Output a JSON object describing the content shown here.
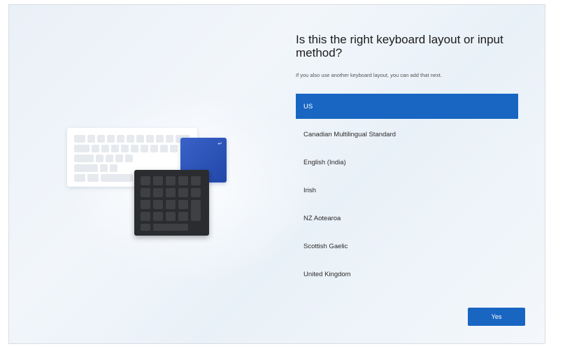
{
  "window": {
    "title": "Is this the right keyboard layout or input method?",
    "subtitle": "If you also use another keyboard layout, you can add that next."
  },
  "layouts": {
    "selected": "US",
    "items": [
      {
        "label": "US"
      },
      {
        "label": "Canadian Multilingual Standard"
      },
      {
        "label": "English (India)"
      },
      {
        "label": "Irish"
      },
      {
        "label": "NZ Aotearoa"
      },
      {
        "label": "Scottish Gaelic"
      },
      {
        "label": "United Kingdom"
      }
    ]
  },
  "buttons": {
    "yes": "Yes"
  },
  "illustration": {
    "icon": "keyboard-illustration",
    "enter_glyph": "↵"
  },
  "colors": {
    "accent": "#1966c2",
    "numpad": "#2b2c2f",
    "card": "#2a52b8"
  }
}
